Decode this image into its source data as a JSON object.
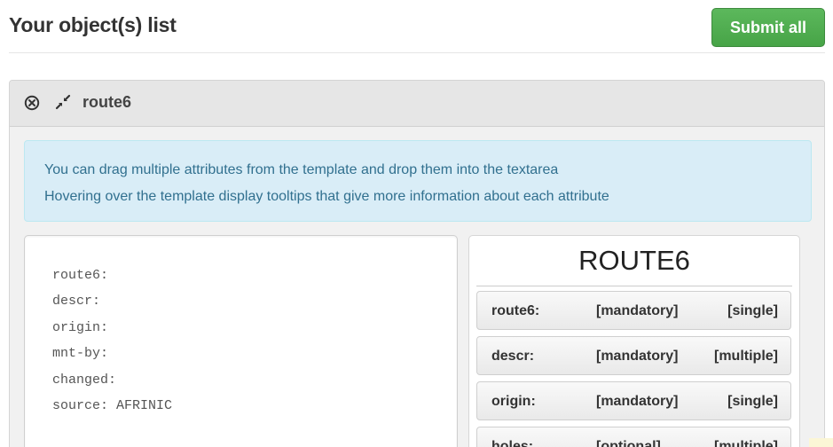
{
  "header": {
    "title": "Your object(s) list",
    "submit_label": "Submit all"
  },
  "panel": {
    "title": "route6",
    "close_icon": "close-circle-icon",
    "collapse_icon": "compress-arrows-icon",
    "info": [
      "You can drag multiple attributes from the template and drop them into the textarea",
      "Hovering over the template display tooltips that give more information about each attribute"
    ],
    "textarea_lines": [
      "route6:",
      "descr:",
      "origin:",
      "mnt-by:",
      "changed:",
      "source: AFRINIC"
    ],
    "template": {
      "title": "ROUTE6",
      "attributes": [
        {
          "name": "route6:",
          "requirement": "[mandatory]",
          "cardinality": "[single]"
        },
        {
          "name": "descr:",
          "requirement": "[mandatory]",
          "cardinality": "[multiple]"
        },
        {
          "name": "origin:",
          "requirement": "[mandatory]",
          "cardinality": "[single]"
        },
        {
          "name": "holes:",
          "requirement": "[optional]",
          "cardinality": "[multiple]"
        }
      ]
    }
  },
  "colors": {
    "submit_green": "#5cb85c",
    "info_background": "#d9edf7",
    "info_text": "#31708f",
    "panel_heading": "#e6e6e6"
  }
}
